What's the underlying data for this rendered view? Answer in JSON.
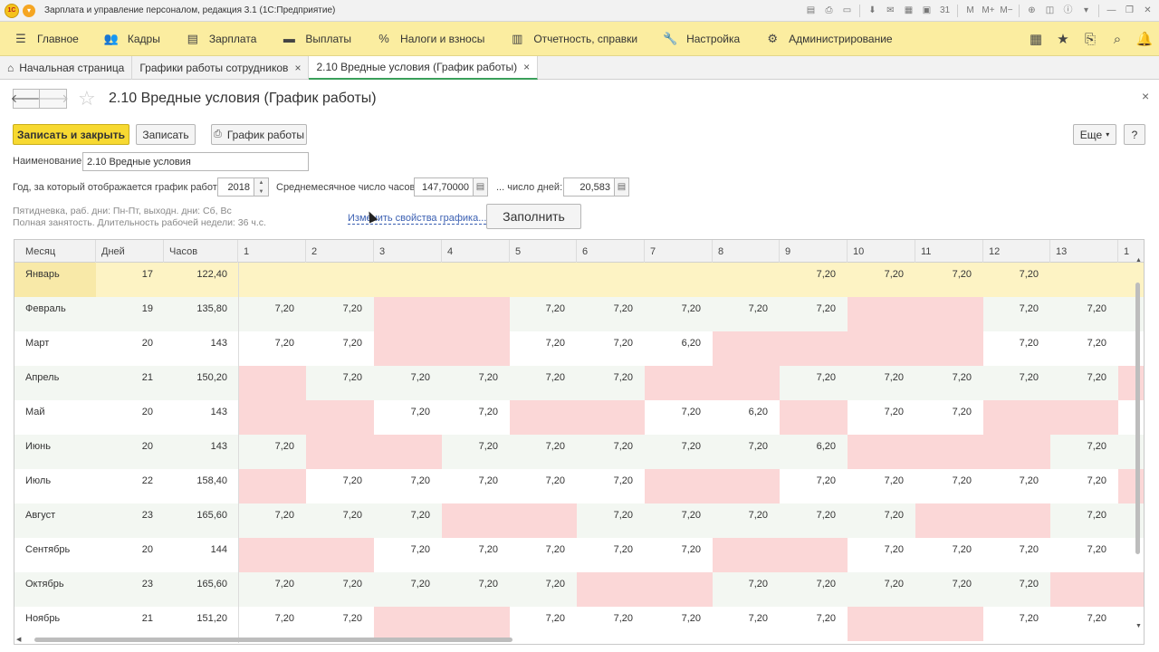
{
  "window": {
    "title": "Зарплата и управление персоналом, редакция 3.1  (1С:Предприятие)",
    "logo_text": "1С",
    "menu_glyph": "▾",
    "tools": [
      {
        "name": "form-icon",
        "glyph": "▤"
      },
      {
        "name": "print-icon",
        "glyph": "⎙"
      },
      {
        "name": "preview-icon",
        "glyph": "▭"
      },
      {
        "name": "save-icon",
        "glyph": "⬇"
      },
      {
        "name": "envelope-icon",
        "glyph": "✉"
      },
      {
        "name": "table-icon",
        "glyph": "▦"
      },
      {
        "name": "calculator-icon",
        "glyph": "▣"
      },
      {
        "name": "calendar-icon",
        "glyph": "31"
      },
      {
        "name": "memory-m-icon",
        "glyph": "M"
      },
      {
        "name": "memory-mplus-icon",
        "glyph": "M+"
      },
      {
        "name": "memory-mminus-icon",
        "glyph": "M−"
      },
      {
        "name": "zoom-icon",
        "glyph": "⊕"
      },
      {
        "name": "panels-icon",
        "glyph": "◫"
      },
      {
        "name": "info-icon",
        "glyph": "ⓘ"
      },
      {
        "name": "dropdown-icon",
        "glyph": "▾"
      },
      {
        "name": "minimize-icon",
        "glyph": "—"
      },
      {
        "name": "restore-icon",
        "glyph": "❐"
      },
      {
        "name": "close-icon",
        "glyph": "✕"
      }
    ]
  },
  "main_menu": [
    {
      "name": "menu-main",
      "label": "Главное",
      "glyph": "☰"
    },
    {
      "name": "menu-staff",
      "label": "Кадры",
      "glyph": "👥"
    },
    {
      "name": "menu-salary",
      "label": "Зарплата",
      "glyph": "▤"
    },
    {
      "name": "menu-payments",
      "label": "Выплаты",
      "glyph": "▬"
    },
    {
      "name": "menu-taxes",
      "label": "Налоги и взносы",
      "glyph": "%"
    },
    {
      "name": "menu-reports",
      "label": "Отчетность, справки",
      "glyph": "▥"
    },
    {
      "name": "menu-settings",
      "label": "Настройка",
      "glyph": "🔧"
    },
    {
      "name": "menu-admin",
      "label": "Администрирование",
      "glyph": "⚙"
    }
  ],
  "menu_right": [
    {
      "name": "apps-grid-icon",
      "glyph": "▦"
    },
    {
      "name": "favorites-star-icon",
      "glyph": "★"
    },
    {
      "name": "history-icon",
      "glyph": "⎘"
    },
    {
      "name": "search-icon",
      "glyph": "⌕"
    },
    {
      "name": "bell-icon",
      "glyph": "🔔"
    }
  ],
  "tabs": [
    {
      "label": "Начальная страница",
      "home": true,
      "close": false,
      "active": false
    },
    {
      "label": "Графики работы сотрудников",
      "home": false,
      "close": true,
      "active": false
    },
    {
      "label": "2.10 Вредные условия (График работы)",
      "home": false,
      "close": true,
      "active": true
    }
  ],
  "form": {
    "title": "2.10 Вредные условия (График работы)",
    "back_glyph": "🡐",
    "forward_glyph": "🡒",
    "star_glyph": "☆",
    "close_glyph": "×",
    "save_close_label": "Записать и закрыть",
    "save_label": "Записать",
    "schedule_label": "График работы",
    "printer_glyph": "⎙",
    "more_label": "Еще",
    "more_arrow": "▾",
    "help_label": "?",
    "name_label": "Наименование:",
    "name_value": "2.10 Вредные условия",
    "year_label": "Год, за который отображается график работы:",
    "year_value": "2018",
    "avg_hours_label": "Среднемесячное число часов:",
    "avg_hours_value": "147,70000",
    "days_label": "... число дней:",
    "days_value": "20,583",
    "calc_glyph": "▤",
    "desc_line1": "Пятидневка, раб. дни: Пн-Пт, выходн. дни: Сб, Вс",
    "desc_line2": "Полная занятость. Длительность рабочей недели: 36 ч.с.",
    "change_link": "Изменить свойства графика...",
    "fill_label": "Заполнить"
  },
  "table": {
    "headers": [
      "Месяц",
      "Дней",
      "Часов",
      "1",
      "2",
      "3",
      "4",
      "5",
      "6",
      "7",
      "8",
      "9",
      "10",
      "11",
      "12",
      "13",
      "1"
    ],
    "rows": [
      {
        "month": "Январь",
        "days": "17",
        "hours": "122,40",
        "selected": true,
        "cells": [
          null,
          null,
          null,
          null,
          null,
          null,
          null,
          null,
          "7,20",
          "7,20",
          "7,20",
          "7,20",
          null,
          null
        ]
      },
      {
        "month": "Февраль",
        "days": "19",
        "hours": "135,80",
        "cells": [
          "7,20",
          "7,20",
          "",
          "",
          "7,20",
          "7,20",
          "7,20",
          "7,20",
          "7,20",
          "",
          "",
          "7,20",
          "7,20",
          null
        ]
      },
      {
        "month": "Март",
        "days": "20",
        "hours": "143",
        "cells": [
          "7,20",
          "7,20",
          "",
          "",
          "7,20",
          "7,20",
          "6,20",
          "",
          "",
          "",
          "",
          "7,20",
          "7,20",
          null
        ]
      },
      {
        "month": "Апрель",
        "days": "21",
        "hours": "150,20",
        "cells": [
          "",
          "7,20",
          "7,20",
          "7,20",
          "7,20",
          "7,20",
          "",
          "",
          "7,20",
          "7,20",
          "7,20",
          "7,20",
          "7,20",
          ""
        ]
      },
      {
        "month": "Май",
        "days": "20",
        "hours": "143",
        "cells": [
          "",
          "",
          "7,20",
          "7,20",
          "",
          "",
          "7,20",
          "6,20",
          "",
          "7,20",
          "7,20",
          "",
          "",
          null
        ]
      },
      {
        "month": "Июнь",
        "days": "20",
        "hours": "143",
        "cells": [
          "7,20",
          "",
          "",
          "7,20",
          "7,20",
          "7,20",
          "7,20",
          "7,20",
          "6,20",
          "",
          "",
          "",
          "7,20",
          null
        ]
      },
      {
        "month": "Июль",
        "days": "22",
        "hours": "158,40",
        "cells": [
          "",
          "7,20",
          "7,20",
          "7,20",
          "7,20",
          "7,20",
          "",
          "",
          "7,20",
          "7,20",
          "7,20",
          "7,20",
          "7,20",
          ""
        ]
      },
      {
        "month": "Август",
        "days": "23",
        "hours": "165,60",
        "cells": [
          "7,20",
          "7,20",
          "7,20",
          "",
          "",
          "7,20",
          "7,20",
          "7,20",
          "7,20",
          "7,20",
          "",
          "",
          "7,20",
          null
        ]
      },
      {
        "month": "Сентябрь",
        "days": "20",
        "hours": "144",
        "cells": [
          "",
          "",
          "7,20",
          "7,20",
          "7,20",
          "7,20",
          "7,20",
          "",
          "",
          "7,20",
          "7,20",
          "7,20",
          "7,20",
          null
        ]
      },
      {
        "month": "Октябрь",
        "days": "23",
        "hours": "165,60",
        "cells": [
          "7,20",
          "7,20",
          "7,20",
          "7,20",
          "7,20",
          "",
          "",
          "7,20",
          "7,20",
          "7,20",
          "7,20",
          "7,20",
          "",
          ""
        ]
      },
      {
        "month": "Ноябрь",
        "days": "21",
        "hours": "151,20",
        "cells": [
          "7,20",
          "7,20",
          "",
          "",
          "7,20",
          "7,20",
          "7,20",
          "7,20",
          "7,20",
          "",
          "",
          "7,20",
          "7,20",
          null
        ]
      }
    ],
    "colors": {
      "off_day": "#fbd7d7",
      "selected_row": "#fdf3c4",
      "stripe": "#f3f7f2",
      "white": "#ffffff"
    }
  }
}
